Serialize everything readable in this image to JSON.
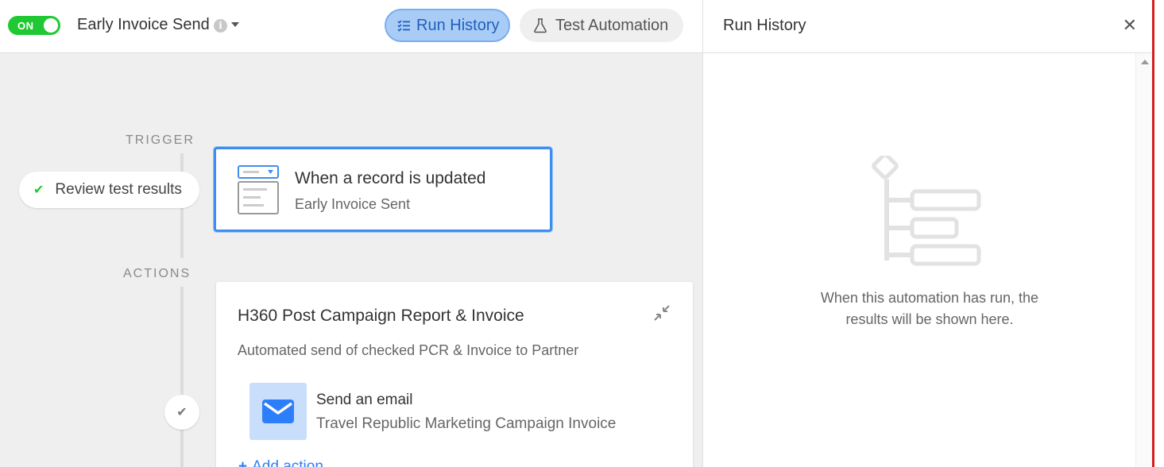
{
  "header": {
    "toggle": {
      "label": "ON",
      "on": true
    },
    "automation_name": "Early Invoice Send",
    "run_history_label": "Run History",
    "test_automation_label": "Test Automation"
  },
  "canvas": {
    "trigger_label": "TRIGGER",
    "actions_label": "ACTIONS",
    "review_button_label": "Review test results",
    "trigger": {
      "title": "When a record is updated",
      "subtitle": "Early Invoice Sent"
    },
    "action_group": {
      "title": "H360 Post Campaign Report & Invoice",
      "description": "Automated send of checked PCR & Invoice to Partner",
      "step": {
        "title": "Send an email",
        "subtitle": "Travel Republic Marketing Campaign Invoice"
      },
      "add_action_label": "Add action"
    }
  },
  "panel": {
    "title": "Run History",
    "empty_message": "When this automation has run, the results will be shown here."
  },
  "colors": {
    "toggle_on": "#20c933",
    "accent_blue": "#2d7ff9",
    "run_history_bg": "#a9ccf7",
    "canvas_bg": "#efefef",
    "edge_red": "#d51f1f"
  },
  "icons": [
    "info-icon",
    "chevron-down-icon",
    "checklist-icon",
    "flask-icon",
    "check-icon",
    "record-form-icon",
    "collapse-icon",
    "envelope-icon",
    "plus-icon",
    "close-icon",
    "flow-tree-icon"
  ]
}
